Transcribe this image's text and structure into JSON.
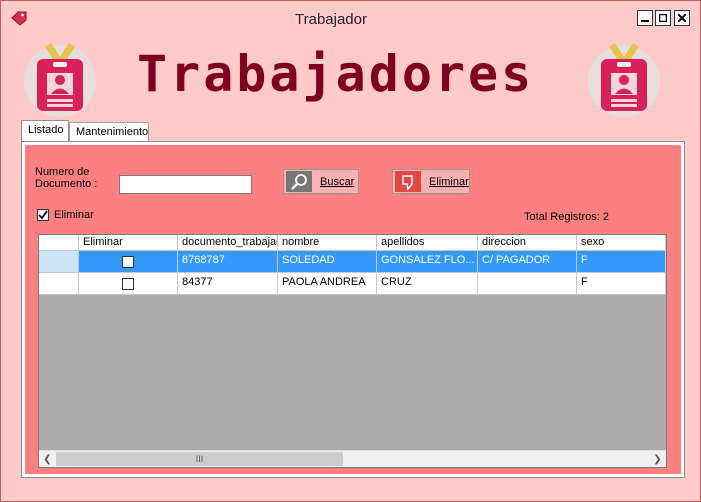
{
  "window": {
    "title": "Trabajador",
    "controls": [
      "minimize",
      "maximize",
      "close"
    ]
  },
  "banner": {
    "heading": "Trabajadores"
  },
  "tabs": [
    {
      "label": "Listado",
      "active": true
    },
    {
      "label": "Mantenimiento",
      "active": false
    }
  ],
  "search": {
    "label_line1": "Numero de",
    "label_line2": "Documento :",
    "value": "",
    "search_button": "Buscar",
    "delete_button": "Eliminar"
  },
  "eliminar_checkbox": {
    "label": "Eliminar",
    "checked": true
  },
  "total": "Total Registros: 2",
  "grid": {
    "columns": [
      "Eliminar",
      "documento_trabajador",
      "nombre",
      "apellidos",
      "direccion",
      "sexo"
    ],
    "rows": [
      {
        "eliminar": false,
        "documento": "8768787",
        "nombre": "SOLEDAD",
        "apellidos": "GONSALEZ FLO...",
        "direccion": "C/ PAGADOR",
        "sexo": "F",
        "selected": true
      },
      {
        "eliminar": false,
        "documento": "84377",
        "nombre": "PAOLA ANDREA",
        "apellidos": "CRUZ",
        "direccion": "",
        "sexo": "F",
        "selected": false
      }
    ],
    "scroll_thumb_glyph": "III"
  },
  "colors": {
    "background": "#FFCACA",
    "panel": "#FF8080",
    "selection": "#3399FF",
    "accent": "#80001F"
  }
}
